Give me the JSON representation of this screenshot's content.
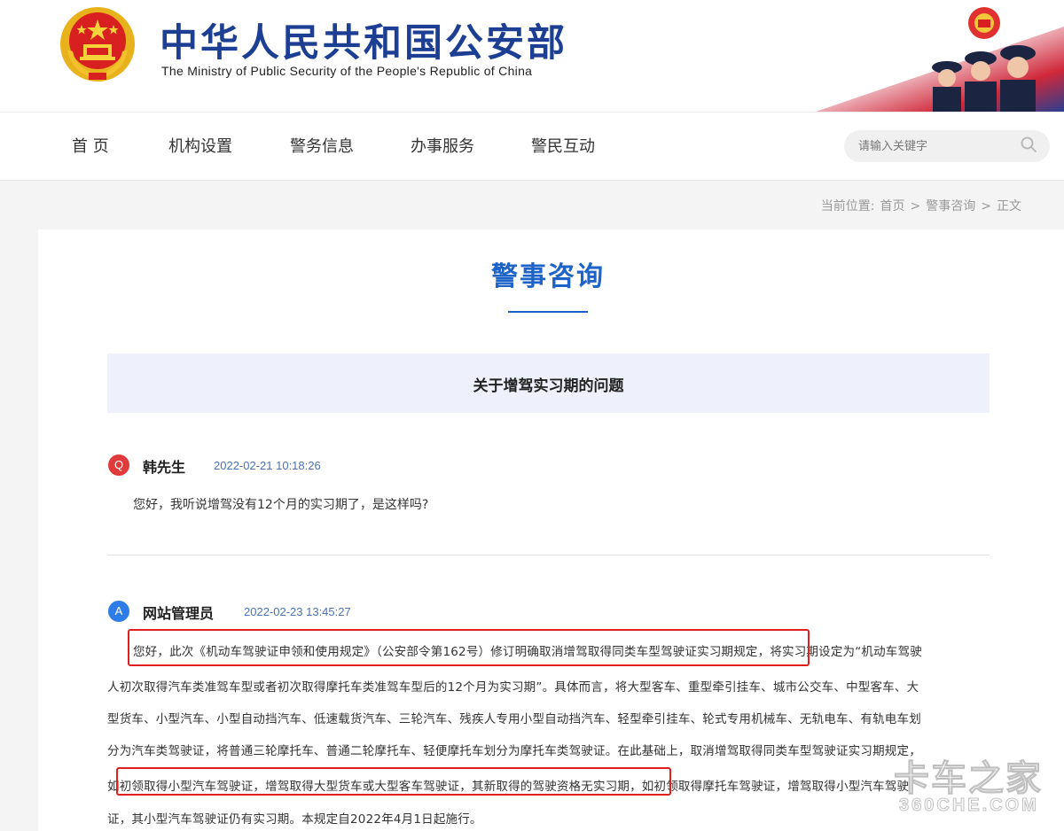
{
  "header": {
    "title_cn": "中华人民共和国公安部",
    "title_en": "The Ministry of Public Security of the People's Republic of China"
  },
  "nav": {
    "items": [
      "首 页",
      "机构设置",
      "警务信息",
      "办事服务",
      "警民互动"
    ],
    "search_placeholder": "请输入关键字"
  },
  "breadcrumb": {
    "prefix": "当前位置:",
    "home": "首页",
    "sep": ">",
    "section": "警事咨询",
    "current": "正文"
  },
  "main": {
    "title": "警事咨询",
    "subject": "关于增驾实习期的问题",
    "question": {
      "badge": "Q",
      "author": "韩先生",
      "time": "2022-02-21 10:18:26",
      "text": "您好，我听说增驾没有12个月的实习期了，是这样吗?"
    },
    "answer": {
      "badge": "A",
      "author": "网站管理员",
      "time": "2022-02-23 13:45:27",
      "lines": [
        "您好，此次《机动车驾驶证申领和使用规定》（公安部令第162号）修订明确取消增驾取得同类车型驾驶证实习期规定，将实习期设定为“机动车驾驶",
        "人初次取得汽车类准驾车型或者初次取得摩托车类准驾车型后的12个月为实习期”。具体而言，将大型客车、重型牵引挂车、城市公交车、中型客车、大",
        "型货车、小型汽车、小型自动挡汽车、低速载货汽车、三轮汽车、残疾人专用小型自动挡汽车、轻型牵引挂车、轮式专用机械车、无轨电车、有轨电车划",
        "分为汽车类驾驶证，将普通三轮摩托车、普通二轮摩托车、轻便摩托车划分为摩托车类驾驶证。在此基础上，取消增驾取得同类车型驾驶证实习期规定，",
        "如初领取得小型汽车驾驶证，增驾取得大型货车或大型客车驾驶证，其新取得的驾驶资格无实习期，如初领取得摩托车驾驶证，增驾取得小型汽车驾驶",
        "证，其小型汽车驾驶证仍有实习期。本规定自2022年4月1日起施行。"
      ]
    }
  },
  "watermark": {
    "cn": "卡车之家",
    "en": "360CHE.COM"
  },
  "colors": {
    "brand_blue": "#1c3f94",
    "title_blue": "#1e63c8",
    "highlight_red": "#e01f1f"
  }
}
